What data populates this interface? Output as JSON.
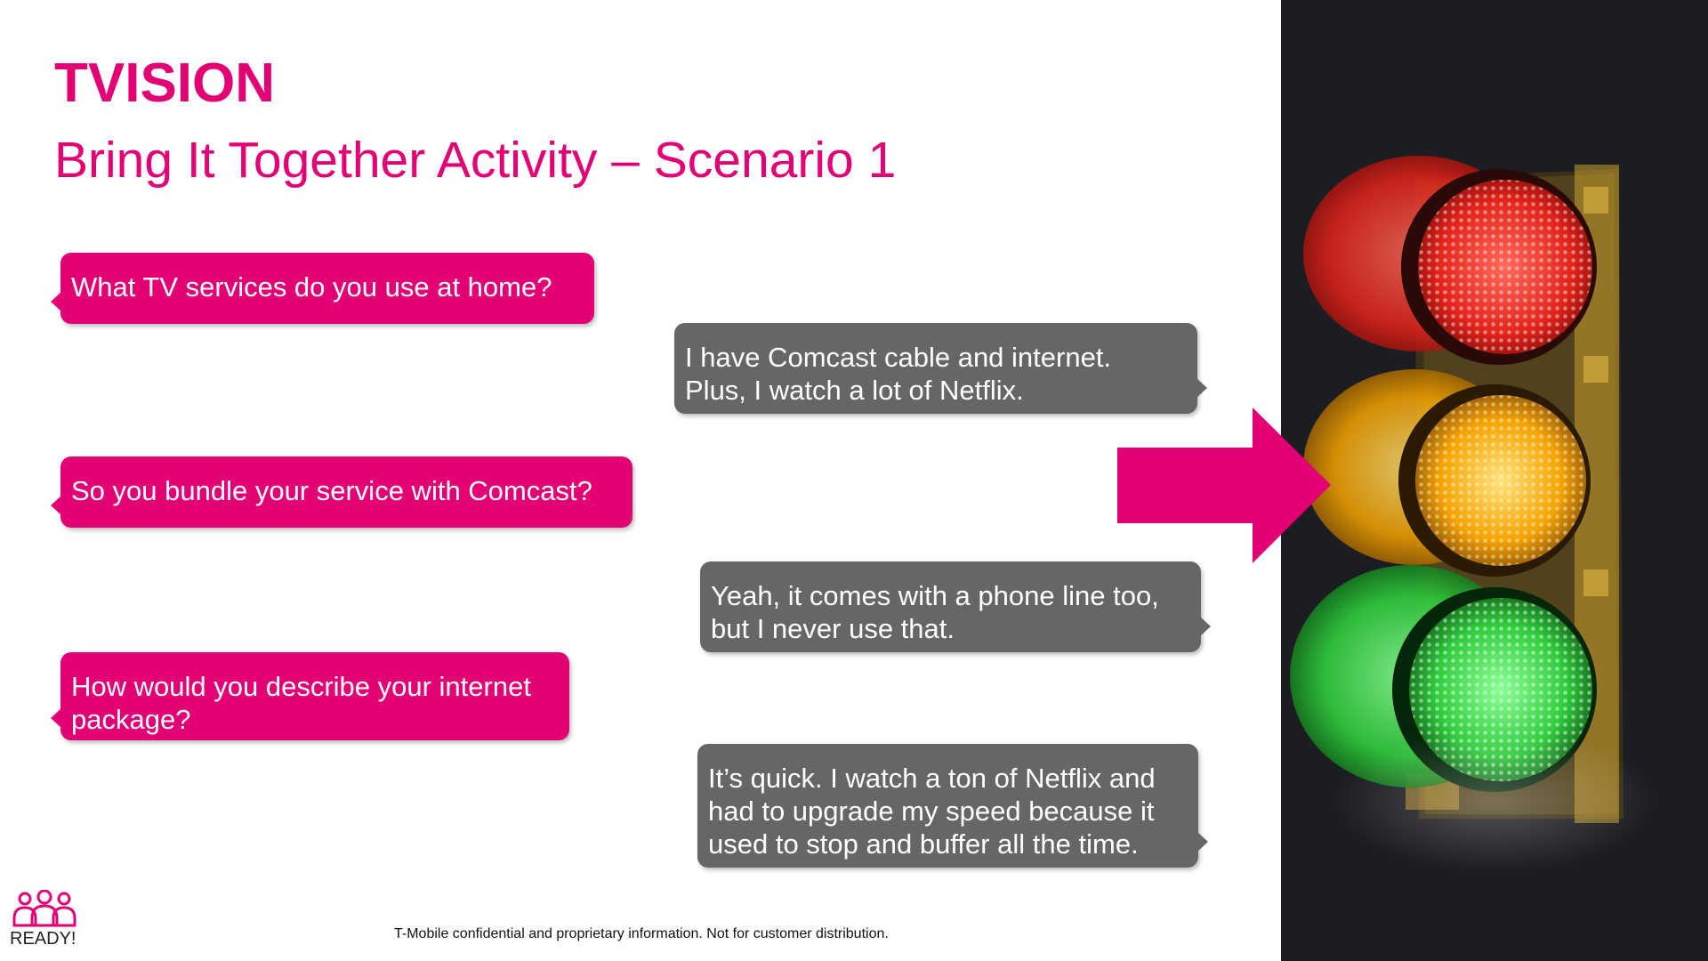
{
  "slide": {
    "title": "TVISION",
    "subtitle": "Bring It Together Activity – Scenario 1"
  },
  "conversation": [
    {
      "speaker": "agent",
      "lines": [
        "What TV services do you use at home?"
      ]
    },
    {
      "speaker": "customer",
      "lines": [
        "I have Comcast cable and internet.",
        "Plus, I watch a lot of Netflix."
      ]
    },
    {
      "speaker": "agent",
      "lines": [
        "So you bundle your service with Comcast?"
      ]
    },
    {
      "speaker": "customer",
      "lines": [
        "Yeah, it comes with a phone line too,",
        "but I never use that."
      ]
    },
    {
      "speaker": "agent",
      "lines": [
        "How would you describe your internet",
        "package?"
      ]
    },
    {
      "speaker": "customer",
      "lines": [
        "It’s quick. I watch a ton of Netflix and",
        "had to upgrade my speed because it",
        "used to stop and buffer all the time."
      ]
    }
  ],
  "logo": {
    "label": "READY!",
    "icon": "team-people-icon"
  },
  "footer": {
    "text": "T-Mobile confidential and proprietary information. Not for customer distribution."
  },
  "colors": {
    "brand": "#e20074",
    "customer_bubble": "#666666",
    "panel": "#1b1d22",
    "light_red": "#ff2a22",
    "light_yellow": "#ffb000",
    "light_green": "#36e24a"
  },
  "illustration": {
    "icon": "traffic-light-icon"
  }
}
